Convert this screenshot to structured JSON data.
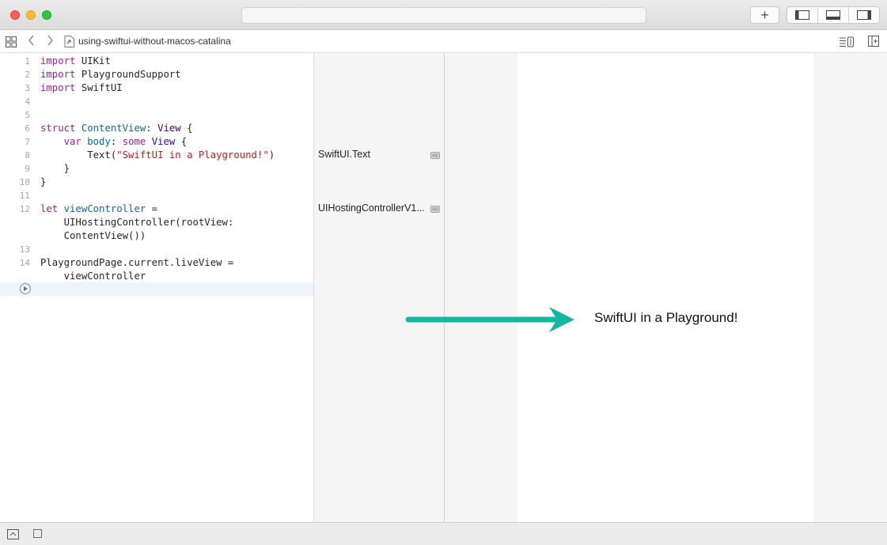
{
  "window": {
    "traffic_lights": [
      "close",
      "minimize",
      "zoom"
    ],
    "toolbar": {
      "add_label": "+",
      "panel_toggles": [
        "left-panel-icon",
        "bottom-panel-icon",
        "right-panel-icon"
      ]
    }
  },
  "jumpbar": {
    "file_name": "using-swiftui-without-macos-catalina",
    "back_glyph": "‹",
    "forward_glyph": "›"
  },
  "editor": {
    "line_numbers": [
      "1",
      "2",
      "3",
      "4",
      "5",
      "6",
      "7",
      "8",
      "9",
      "10",
      "11",
      "12",
      "13",
      "14"
    ],
    "lines": [
      {
        "num": "1",
        "tokens": [
          {
            "t": "import",
            "c": "kw"
          },
          {
            "t": " UIKit",
            "c": ""
          }
        ]
      },
      {
        "num": "2",
        "tokens": [
          {
            "t": "import",
            "c": "kw"
          },
          {
            "t": " PlaygroundSupport",
            "c": ""
          }
        ]
      },
      {
        "num": "3",
        "tokens": [
          {
            "t": "import",
            "c": "kw"
          },
          {
            "t": " SwiftUI",
            "c": ""
          }
        ]
      },
      {
        "num": "4",
        "tokens": []
      },
      {
        "num": "5",
        "tokens": []
      },
      {
        "num": "6",
        "tokens": [
          {
            "t": "struct",
            "c": "kw"
          },
          {
            "t": " ",
            "c": ""
          },
          {
            "t": "ContentView",
            "c": "idt"
          },
          {
            "t": ": ",
            "c": ""
          },
          {
            "t": "View",
            "c": "ty"
          },
          {
            "t": " {",
            "c": ""
          }
        ]
      },
      {
        "num": "7",
        "tokens": [
          {
            "t": "    ",
            "c": ""
          },
          {
            "t": "var",
            "c": "kw"
          },
          {
            "t": " ",
            "c": ""
          },
          {
            "t": "body",
            "c": "idt"
          },
          {
            "t": ": ",
            "c": ""
          },
          {
            "t": "some",
            "c": "kw"
          },
          {
            "t": " ",
            "c": ""
          },
          {
            "t": "View",
            "c": "ty"
          },
          {
            "t": " {",
            "c": ""
          }
        ]
      },
      {
        "num": "8",
        "tokens": [
          {
            "t": "        Text(",
            "c": ""
          },
          {
            "t": "\"SwiftUI in a Playground!\"",
            "c": "str"
          },
          {
            "t": ")",
            "c": ""
          }
        ]
      },
      {
        "num": "9",
        "tokens": [
          {
            "t": "    }",
            "c": ""
          }
        ]
      },
      {
        "num": "10",
        "tokens": [
          {
            "t": "}",
            "c": ""
          }
        ]
      },
      {
        "num": "11",
        "tokens": []
      },
      {
        "num": "12",
        "tokens": [
          {
            "t": "let",
            "c": "kw"
          },
          {
            "t": " ",
            "c": ""
          },
          {
            "t": "viewController",
            "c": "idt"
          },
          {
            "t": " =",
            "c": ""
          }
        ]
      },
      {
        "num": "",
        "tokens": [
          {
            "t": "    UIHostingController(rootView:",
            "c": ""
          }
        ]
      },
      {
        "num": "",
        "tokens": [
          {
            "t": "    ContentView())",
            "c": ""
          }
        ]
      },
      {
        "num": "13",
        "tokens": []
      },
      {
        "num": "14",
        "tokens": [
          {
            "t": "PlaygroundPage.current.liveView =",
            "c": ""
          }
        ]
      },
      {
        "num": "",
        "tokens": [
          {
            "t": "    viewController",
            "c": ""
          }
        ]
      }
    ]
  },
  "results": [
    {
      "label": "SwiftUI.Text",
      "line": "8"
    },
    {
      "label": "UIHostingControllerV1...",
      "line": "12"
    }
  ],
  "liveview": {
    "text": "SwiftUI in a Playground!",
    "arrow_color": "#14b8a0"
  },
  "colors": {
    "keyword": "#9b2393",
    "type": "#3900a0",
    "identifier": "#0f68a0",
    "string": "#c41a16"
  }
}
